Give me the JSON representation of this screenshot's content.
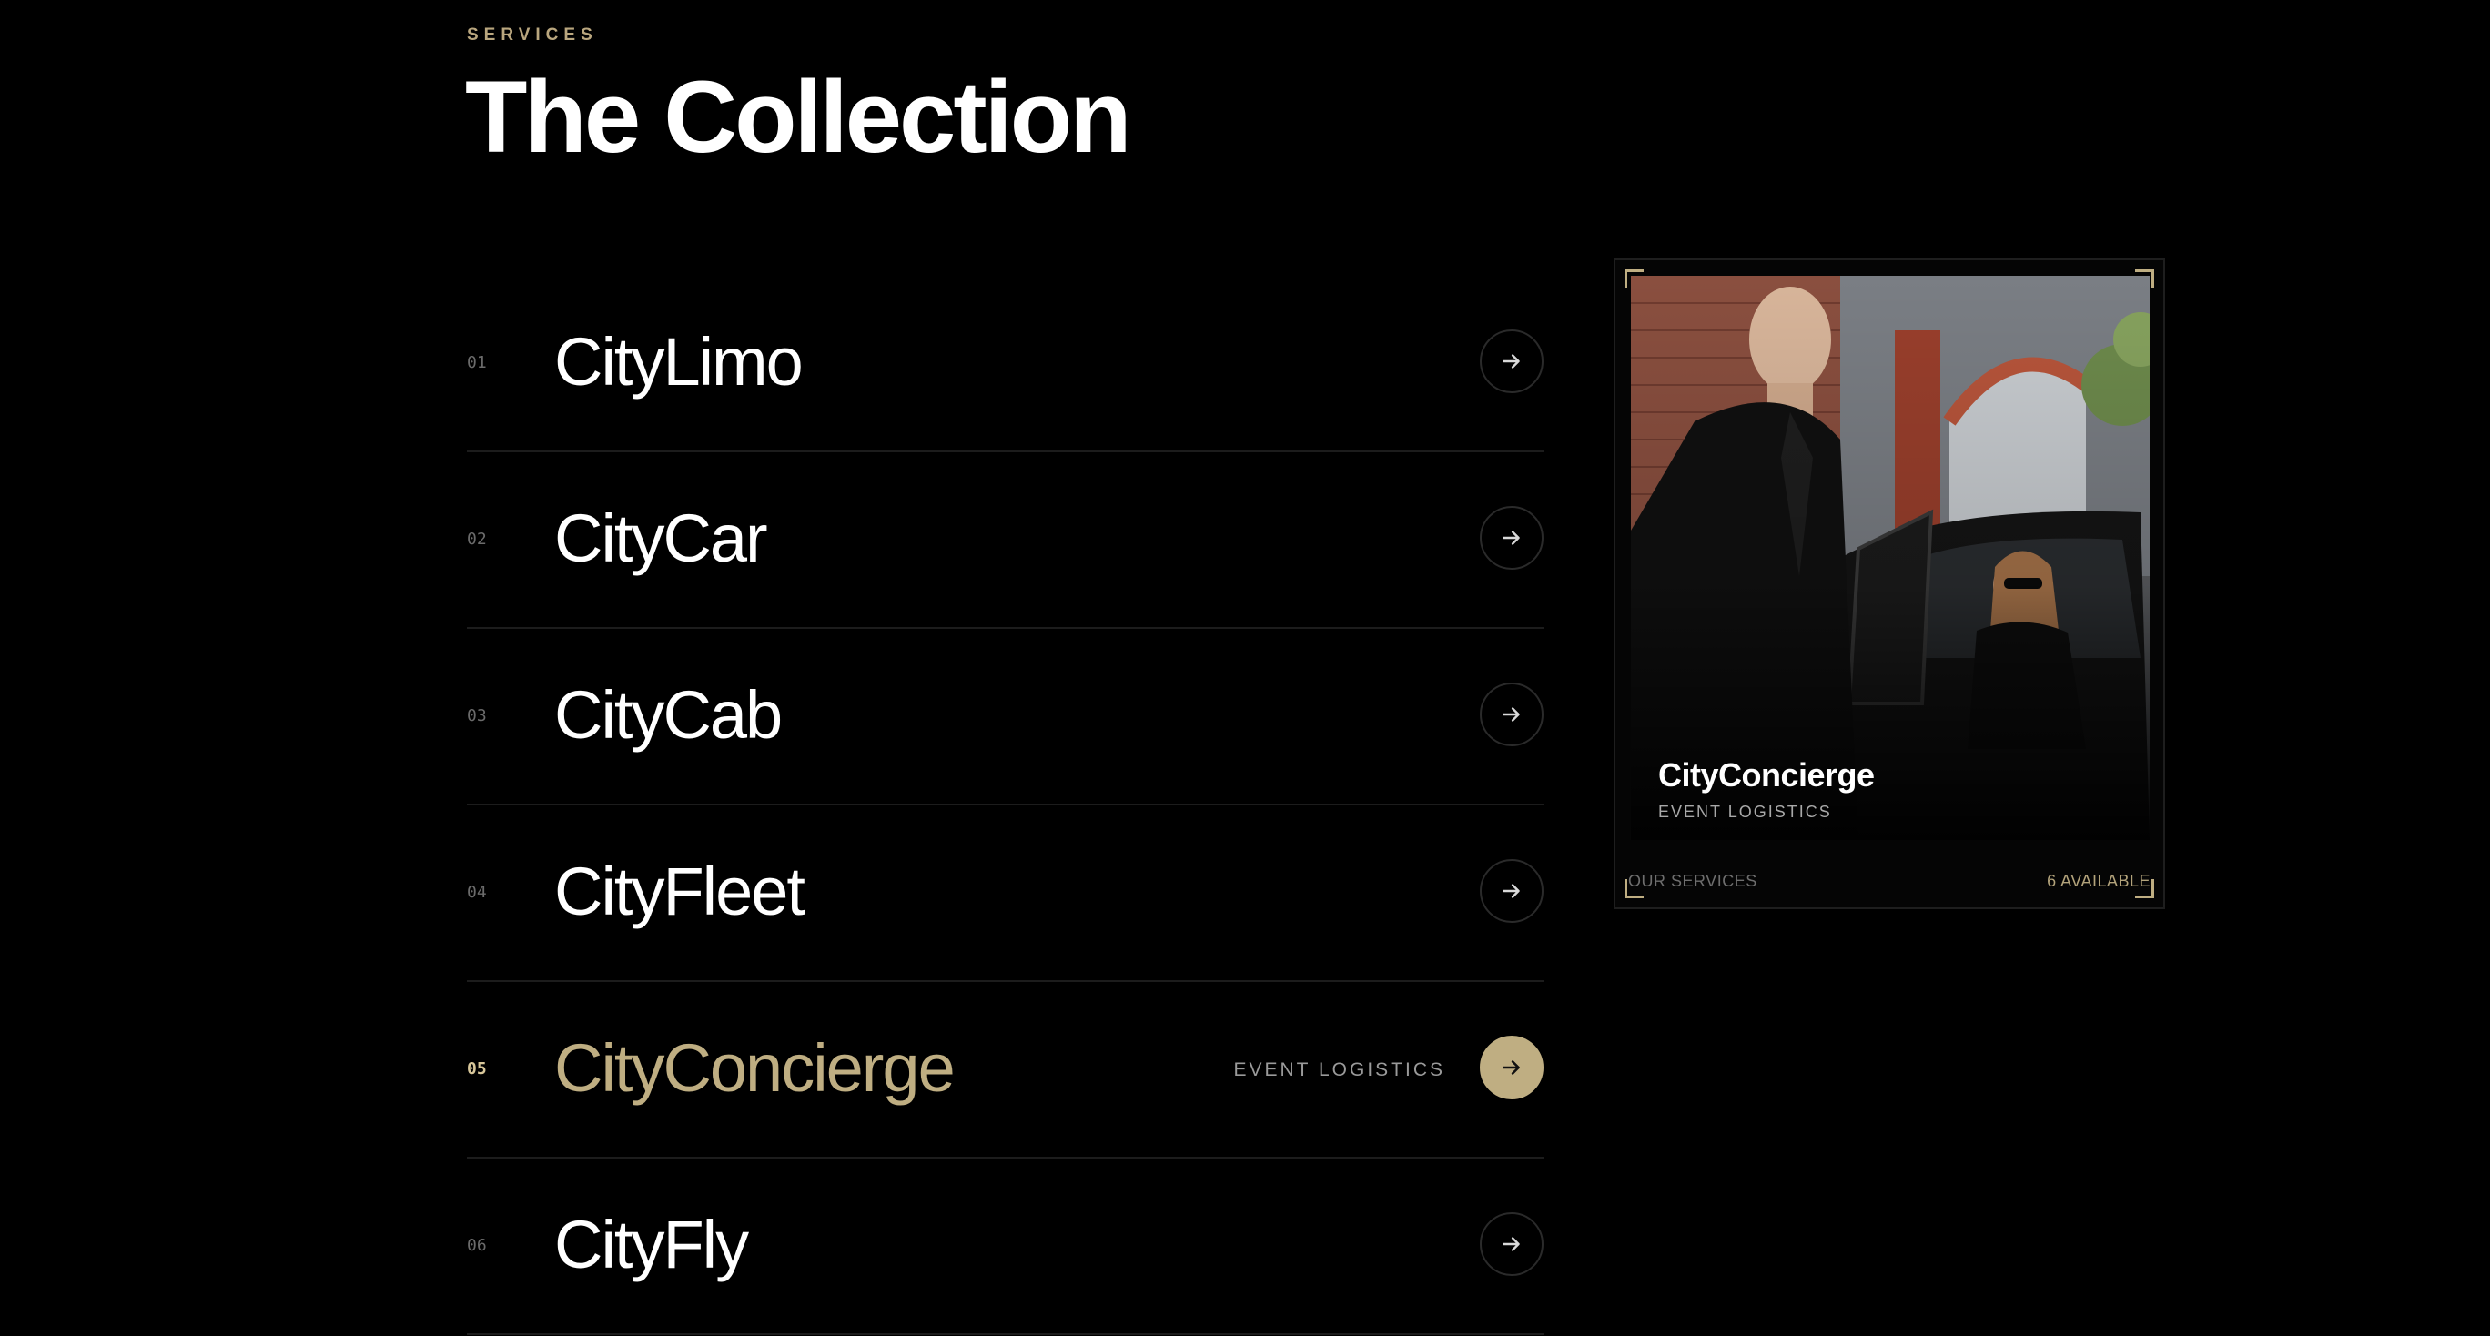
{
  "section": {
    "eyebrow": "SERVICES",
    "title": "The Collection"
  },
  "services": [
    {
      "number": "01",
      "name": "CityLimo",
      "tag": "",
      "active": false
    },
    {
      "number": "02",
      "name": "CityCar",
      "tag": "",
      "active": false
    },
    {
      "number": "03",
      "name": "CityCab",
      "tag": "",
      "active": false
    },
    {
      "number": "04",
      "name": "CityFleet",
      "tag": "",
      "active": false
    },
    {
      "number": "05",
      "name": "CityConcierge",
      "tag": "EVENT LOGISTICS",
      "active": true
    },
    {
      "number": "06",
      "name": "CityFly",
      "tag": "",
      "active": false
    }
  ],
  "preview": {
    "name": "CityConcierge",
    "subtitle": "EVENT LOGISTICS",
    "footer_left": "OUR SERVICES",
    "footer_right": "6 AVAILABLE"
  },
  "icons": {
    "row_button": "arrow-right-icon"
  },
  "colors": {
    "background": "#000000",
    "accent": "#bfae82",
    "divider": "#1c1c1c",
    "muted_text": "#6b6b6b"
  }
}
